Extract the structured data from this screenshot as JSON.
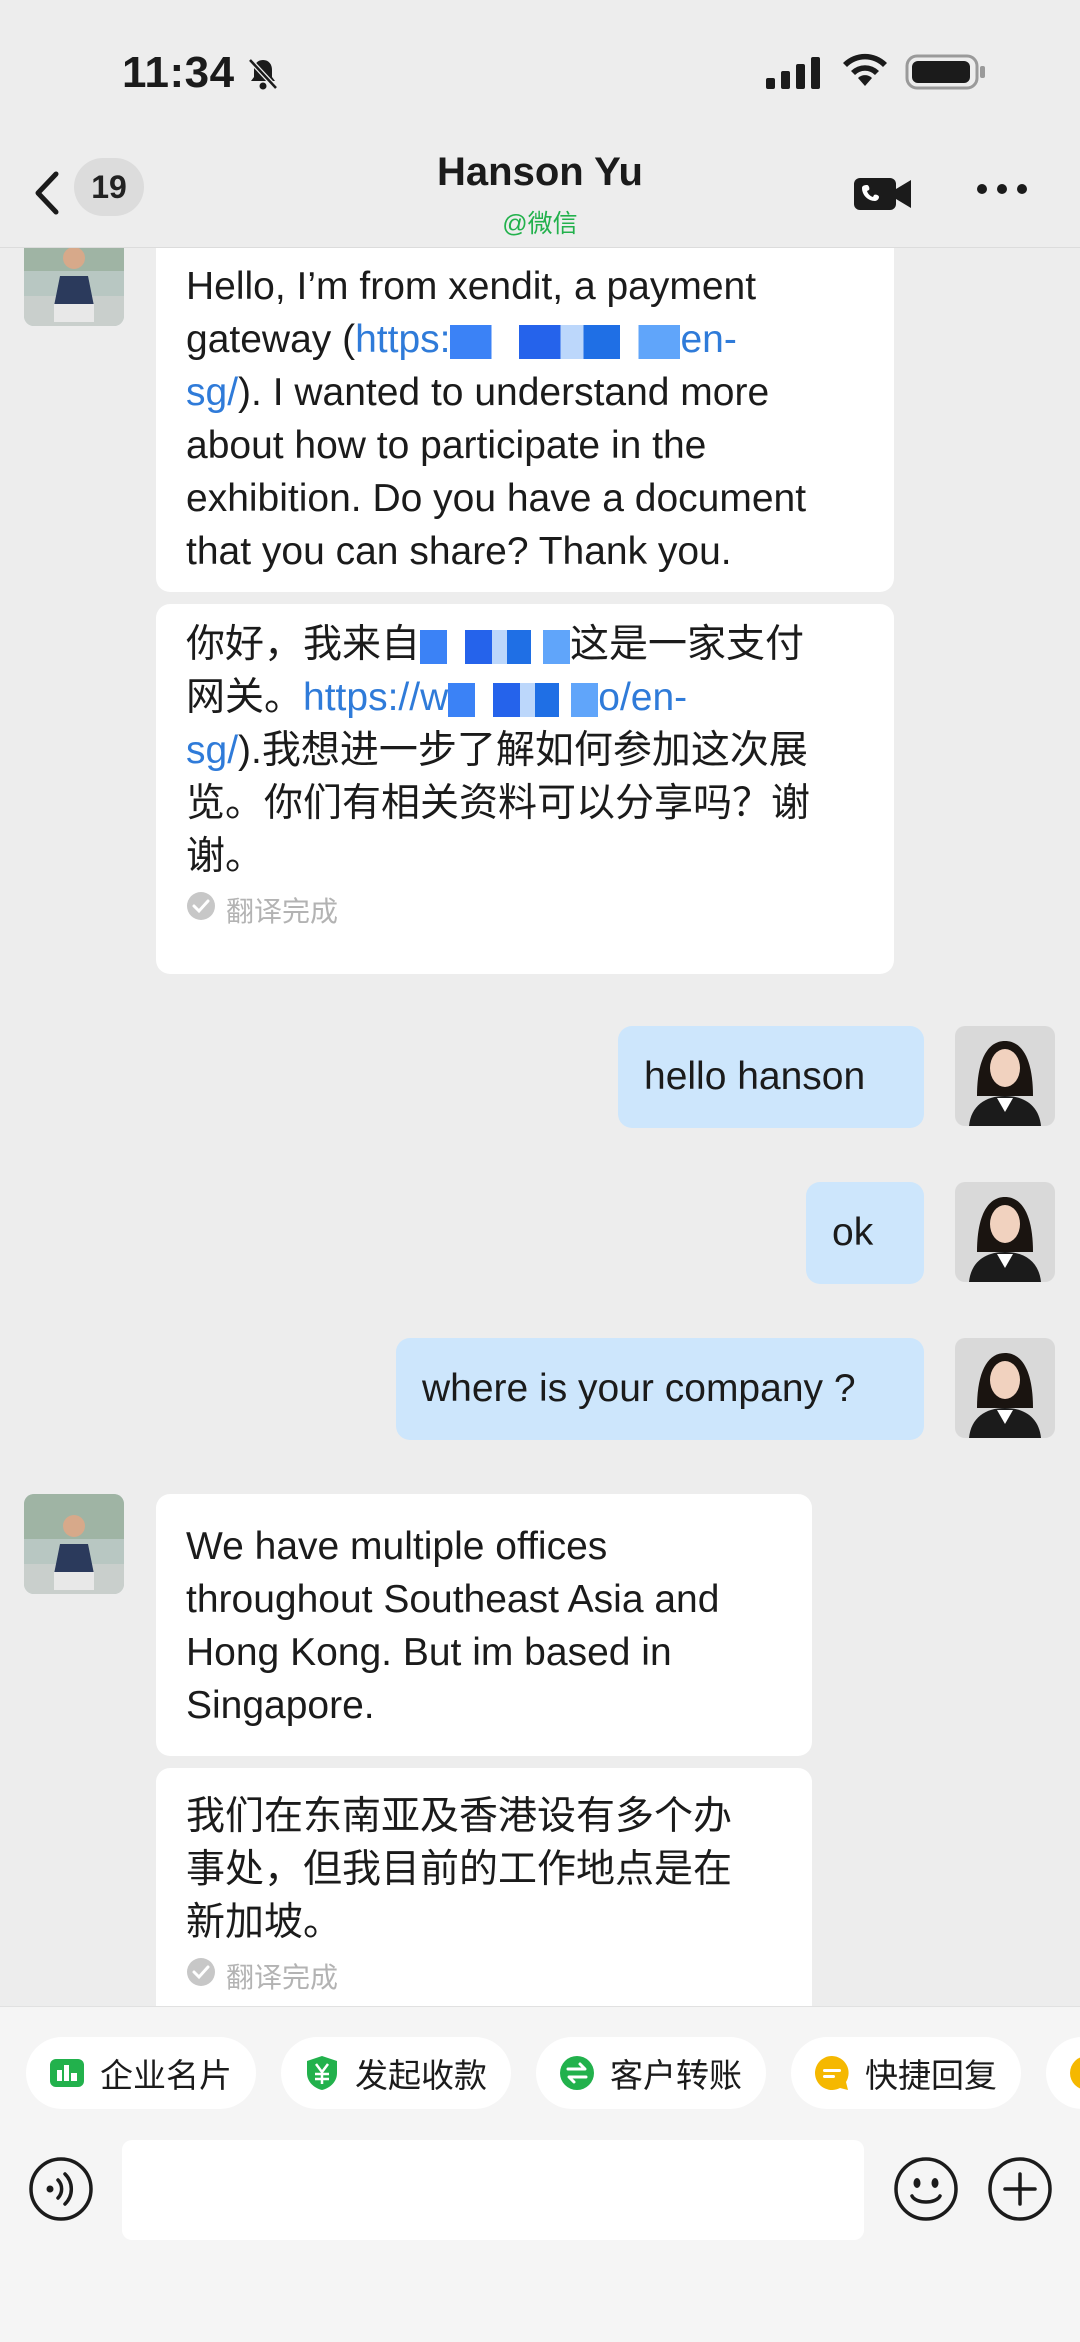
{
  "status_bar": {
    "time": "11:34"
  },
  "header": {
    "unread_count": "19",
    "title": "Hanson Yu",
    "subtitle": "@微信"
  },
  "messages": {
    "m1": {
      "line1_a": "Hello, I’m from xendit, a payment",
      "line2_a": "gateway (",
      "line2_link": "https:",
      "line2_link_end": "en-",
      "line3_link": "sg/",
      "line3_rest": "). I wanted to understand more",
      "line4": "about how to participate in the",
      "line5": "exhibition. Do you have a document",
      "line6": "that you can share? Thank you."
    },
    "m1_translation": {
      "line1_a": "你好，我来自",
      "line1_b": "这是一家支付",
      "line2_a": "网关。",
      "line2_link": "https://w",
      "line2_link_end": "o/en-",
      "line3_link": "sg/",
      "line3_rest": ").我想进一步了解如何参加这次展",
      "line4": "览。你们有相关资料可以分享吗？谢",
      "line5": "谢。",
      "status": "翻译完成"
    },
    "m2": {
      "text": "hello hanson"
    },
    "m3": {
      "text": "ok"
    },
    "m4": {
      "text": "where is your company ?"
    },
    "m5": {
      "line1": "We have multiple offices",
      "line2": "throughout Southeast Asia and",
      "line3": "Hong Kong. But im based in",
      "line4": "Singapore."
    },
    "m5_translation": {
      "line1": "我们在东南亚及香港设有多个办",
      "line2": "事处，但我目前的工作地点是在",
      "line3": "新加坡。",
      "status": "翻译完成"
    }
  },
  "quick_actions": [
    {
      "label": "企业名片",
      "icon": "business-card-icon",
      "color": "#22b14c"
    },
    {
      "label": "发起收款",
      "icon": "payment-shield-icon",
      "color": "#22b14c"
    },
    {
      "label": "客户转账",
      "icon": "transfer-icon",
      "color": "#22b14c"
    },
    {
      "label": "快捷回复",
      "icon": "quick-reply-icon",
      "color": "#f5b800"
    }
  ],
  "input": {
    "placeholder": ""
  },
  "colors": {
    "accent_green": "#22b14c",
    "link_blue": "#2f7bd9",
    "outgoing_bubble": "#cde6fc",
    "background": "#ededed"
  }
}
